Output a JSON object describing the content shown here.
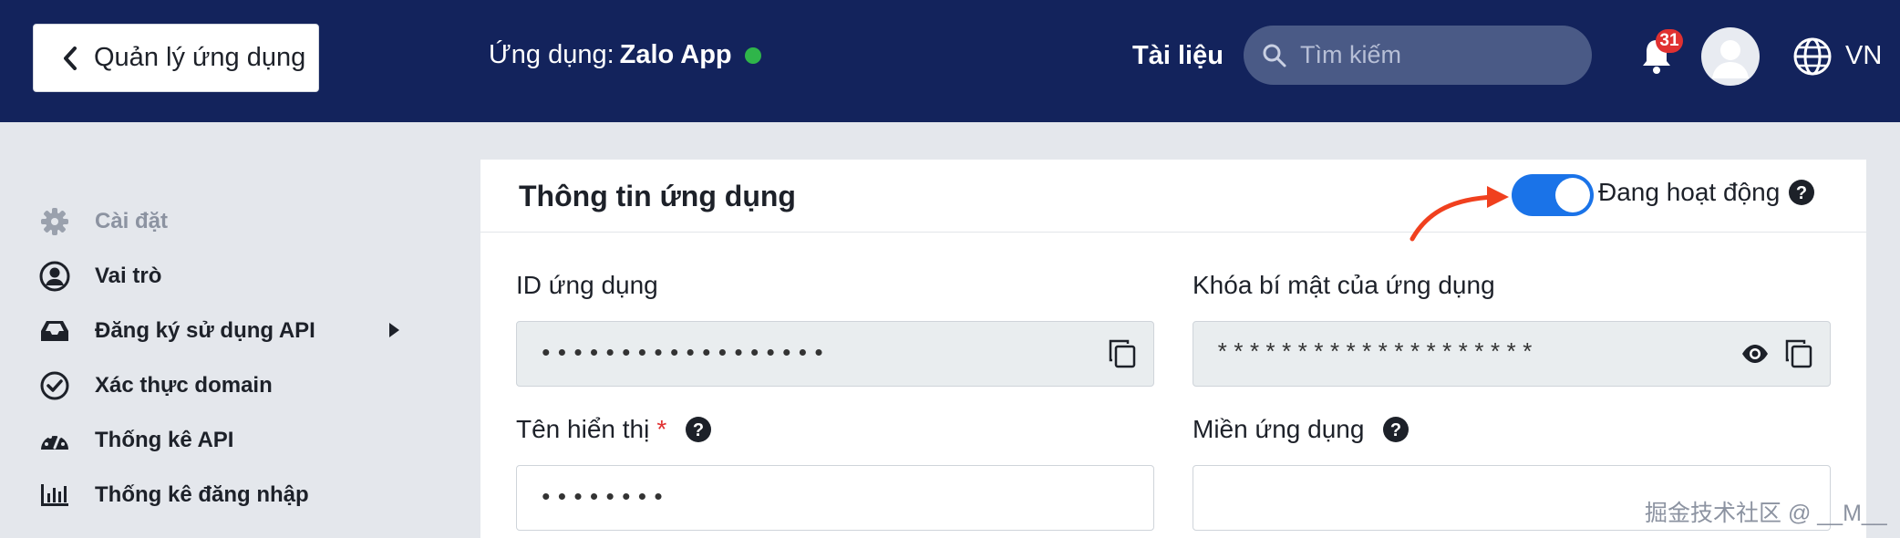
{
  "header": {
    "back_label": "Quản lý ứng dụng",
    "app_prefix": "Ứng dụng:",
    "app_name": "Zalo App",
    "docs_label": "Tài liệu",
    "search_placeholder": "Tìm kiếm",
    "notification_count": "31",
    "language": "VN",
    "status_color": "#2fb54a"
  },
  "sidebar": {
    "items": [
      {
        "label": "Cài đặt",
        "icon": "gear-icon"
      },
      {
        "label": "Vai trò",
        "icon": "user-circle-icon"
      },
      {
        "label": "Đăng ký sử dụng API",
        "icon": "inbox-icon"
      },
      {
        "label": "Xác thực domain",
        "icon": "check-circle-icon"
      },
      {
        "label": "Thống kê API",
        "icon": "gauge-icon"
      },
      {
        "label": "Thống kê đăng nhập",
        "icon": "bar-chart-icon"
      }
    ]
  },
  "panel": {
    "title": "Thông tin ứng dụng",
    "status_label": "Đang hoạt động",
    "toggle_on": true,
    "fields": {
      "app_id_label": "ID ứng dụng",
      "app_id_value": "••••••••••••••••••",
      "secret_label": "Khóa bí mật của ứng dụng",
      "secret_value": "********************",
      "display_name_label": "Tên hiển thị",
      "required_mark": "*",
      "display_name_value": "••••••••",
      "domain_label": "Miền ứng dụng",
      "domain_value": ""
    }
  },
  "watermark": "掘金技术社区 @ __M__",
  "colors": {
    "header_bg": "#13235c",
    "accent": "#1a73e8",
    "badge": "#e03131",
    "arrow": "#f0401e"
  }
}
